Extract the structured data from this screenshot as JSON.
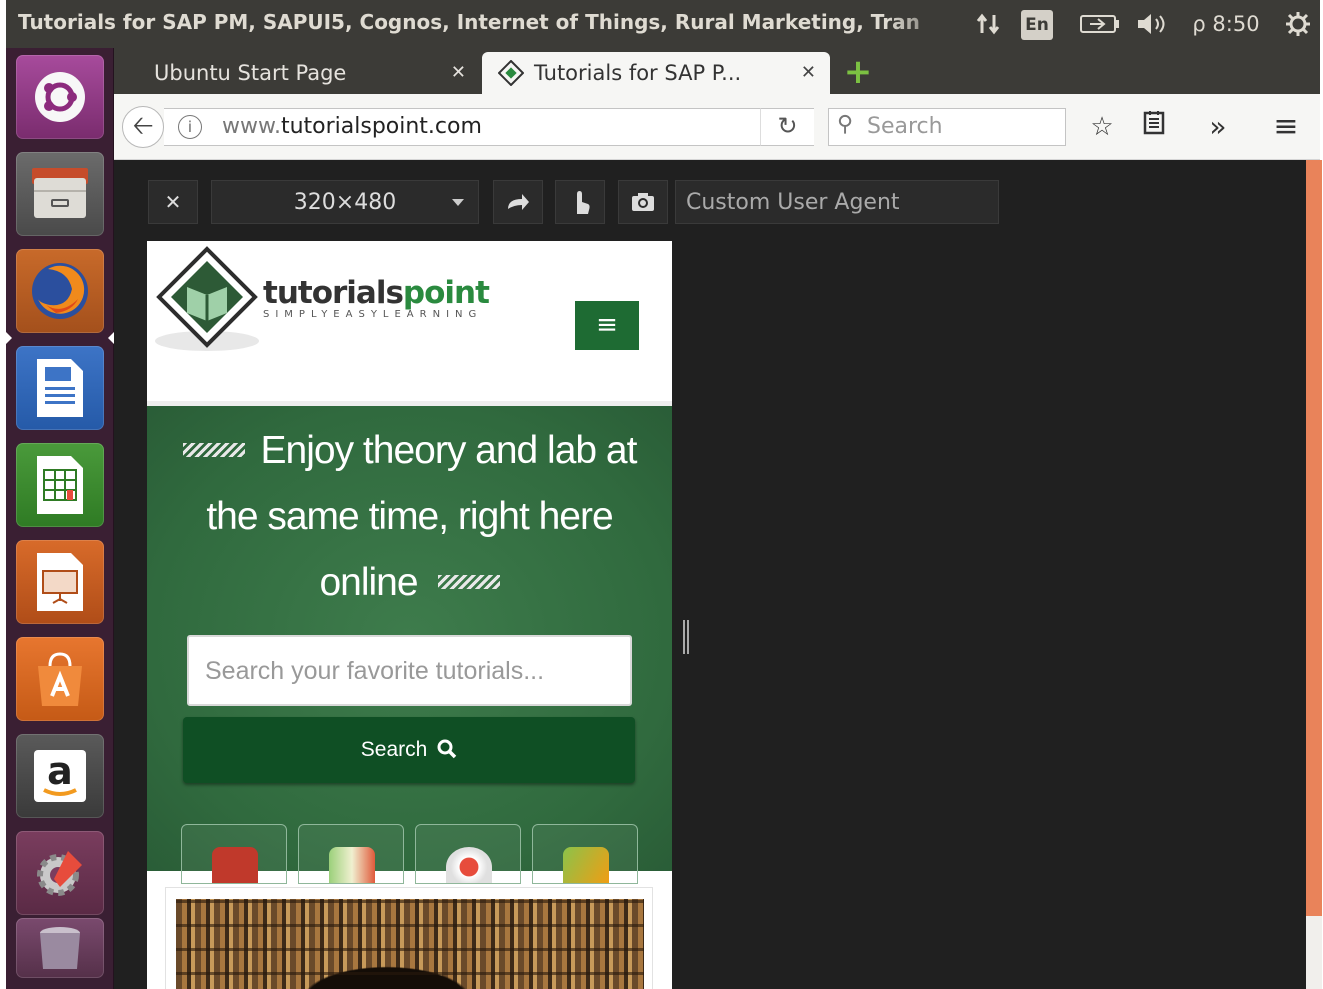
{
  "window": {
    "title": "Tutorials for SAP PM, SAPUI5, Cognos, Internet of Things, Rural Marketing, Tran",
    "keyboard": "En",
    "clock": "ρ 8:50"
  },
  "tabs": [
    {
      "label": "Ubuntu Start Page",
      "active": false
    },
    {
      "label": "Tutorials for SAP P...",
      "active": true
    }
  ],
  "navbar": {
    "url_prefix": "www.",
    "url_domain": "tutorialspoint.com",
    "search_placeholder": "Search"
  },
  "responsive_toolbar": {
    "size": "320×480",
    "user_agent_placeholder": "Custom User Agent"
  },
  "site": {
    "brand_main": "tutorials",
    "brand_accent": "point",
    "brand_tagline": "SIMPLYEASYLEARNING",
    "hero_line1": "Enjoy theory and lab at",
    "hero_line2": "the same time, right here",
    "hero_line3": "online",
    "search_placeholder": "Search your favorite tutorials...",
    "search_button": "Search"
  },
  "colors": {
    "panel": "#3c3b37",
    "launcher": "#3a1f33",
    "accent_green": "#1e6b33",
    "hero_green": "#306a3e",
    "scrollbar_orange": "#e9835a"
  },
  "icons": {
    "launcher": [
      "ubuntu-icon",
      "files-icon",
      "firefox-icon",
      "writer-icon",
      "calc-icon",
      "impress-icon",
      "software-center-icon",
      "amazon-icon",
      "settings-icon",
      "trash-icon"
    ],
    "tray": [
      "network-icon",
      "battery-icon",
      "volume-icon",
      "power-icon"
    ]
  }
}
